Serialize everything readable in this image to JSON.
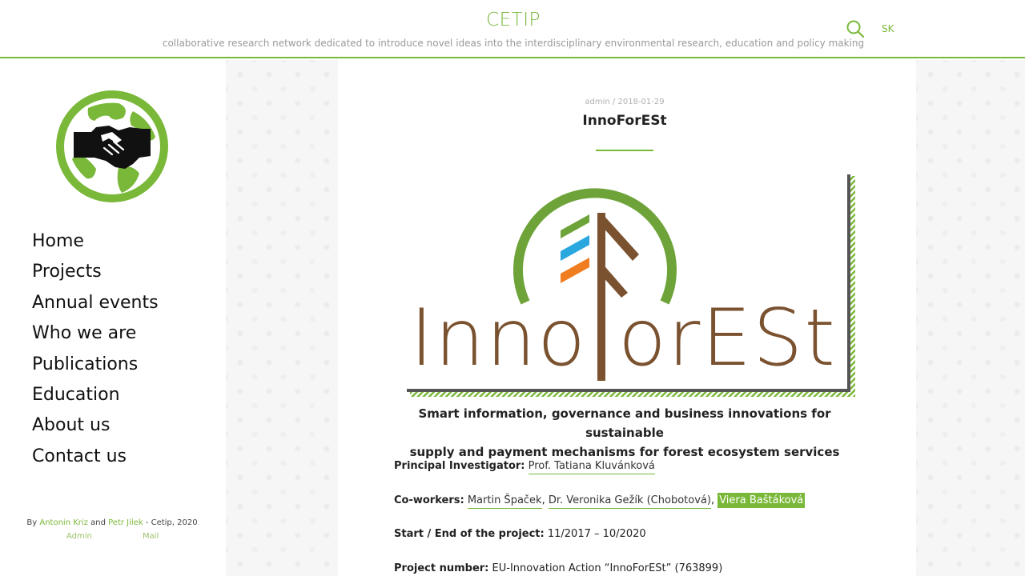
{
  "header": {
    "title": "CETIP",
    "tagline": "collaborative research network dedicated to introduce novel ideas into the interdisciplinary environmental research, education and policy making",
    "lang": "SK",
    "search_icon": "search-icon"
  },
  "colors": {
    "accent": "#7ab839",
    "brown": "#7a5230",
    "blue": "#2ba7df",
    "orange": "#f07d1f"
  },
  "sidebar": {
    "logo_icon": "globe-handshake-logo",
    "nav": [
      "Home",
      "Projects",
      "Annual events",
      "Who we are",
      "Publications",
      "Education",
      "About us",
      "Contact us"
    ],
    "credits": {
      "by": "By",
      "author1": "Antonin Kriz",
      "and": "and",
      "author2": "Petr Jilek",
      "suffix": "- Cetip, 2020",
      "admin": "Admin",
      "mail": "Mail"
    }
  },
  "post": {
    "meta": "admin / 2018-01-29",
    "title": "InnoForESt",
    "logo_text_left": "Inno",
    "logo_text_right": "orESt",
    "subtitle_line1": "Smart information, governance and business innovations for sustainable",
    "subtitle_line2": "supply and payment mechanisms for forest ecosystem services",
    "pi_label": "Principal Investigator:",
    "pi_name": "Prof. Tatiana Kluvánková",
    "coworkers_label": "Co-workers:",
    "coworkers": [
      "Martin Špaček",
      "Dr. Veronika Gežík (Chobotová)",
      "Viera Baštáková"
    ],
    "dates_label": "Start / End of the project:",
    "dates_value": "11/2017 – 10/2020",
    "number_label": "Project number:",
    "number_value": "EU-Innovation Action “InnoForESt” (763899)"
  }
}
